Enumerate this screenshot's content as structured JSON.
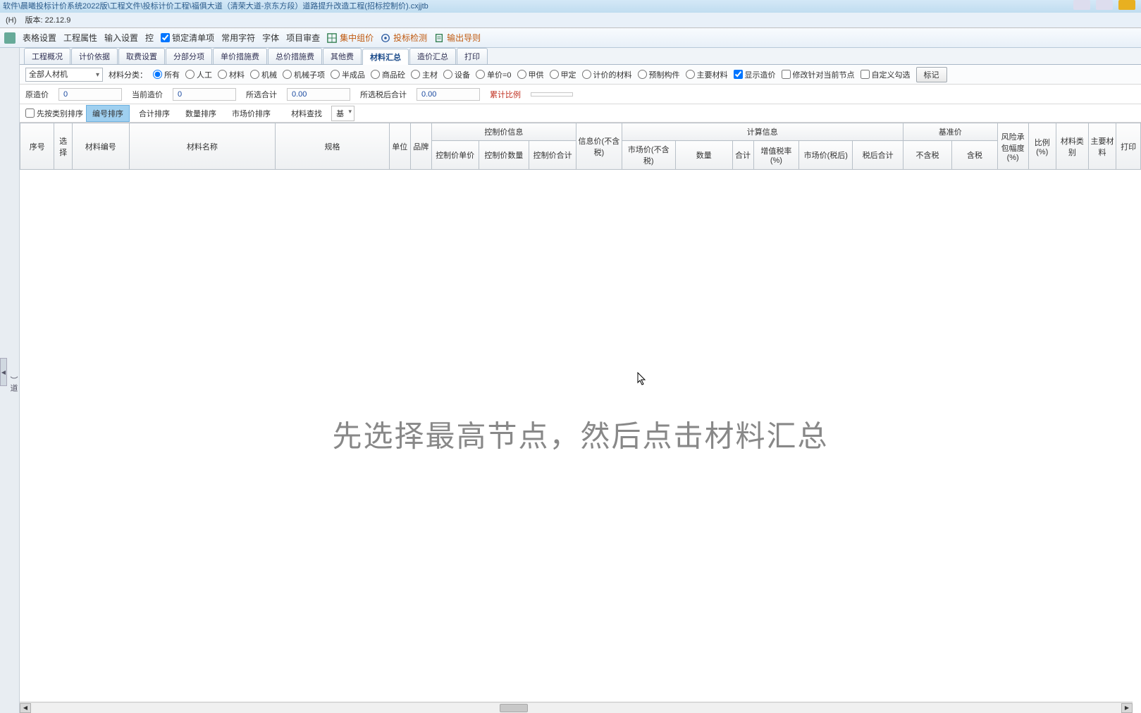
{
  "title_bar": "软件\\晨曦投标计价系统2022版\\工程文件\\投标计价工程\\福俱大道（清荣大道-京东方段）道路提升改造工程(招标控制价).cxjjtb",
  "menu_row": {
    "left": "(H)",
    "version_label": "版本:",
    "version": "22.12.9"
  },
  "toolbar": {
    "items": [
      "表格设置",
      "工程属性",
      "输入设置",
      "控"
    ],
    "lock_chk": "锁定清单项",
    "items2": [
      "常用字符",
      "字体",
      "项目审查"
    ],
    "special": [
      {
        "icon": "grid-icon",
        "label": "集中组价",
        "color": "#c05a10"
      },
      {
        "icon": "target-icon",
        "label": "投标检测",
        "color": "#c05a10"
      },
      {
        "icon": "export-icon",
        "label": "输出导则",
        "color": "#c05a10"
      }
    ]
  },
  "left_strip": "）道",
  "tabs": [
    "工程概况",
    "计价依据",
    "取费设置",
    "分部分项",
    "单价措施费",
    "总价措施费",
    "其他费",
    "材料汇总",
    "造价汇总",
    "打印"
  ],
  "tabs_active_index": 7,
  "filter": {
    "combo": "全部人材机",
    "label": "材料分类：",
    "radios": [
      "所有",
      "人工",
      "材料",
      "机械",
      "机械子项",
      "半成品",
      "商品砼",
      "主材",
      "设备",
      "单价=0",
      "甲供",
      "甲定",
      "计价的材料",
      "预制构件",
      "主要材料"
    ],
    "radio_selected": 0,
    "chks": [
      {
        "label": "显示造价",
        "checked": true
      },
      {
        "label": "修改针对当前节点",
        "checked": false
      },
      {
        "label": "自定义勾选",
        "checked": false
      }
    ],
    "mark_btn": "标记"
  },
  "price_row": {
    "orig_label": "原造价",
    "orig_val": "0",
    "cur_label": "当前造价",
    "cur_val": "0",
    "sel_label": "所选合计",
    "sel_val": "0.00",
    "tax_label": "所选税后合计",
    "tax_val": "0.00",
    "ratio_label": "累计比例",
    "ratio_val": ""
  },
  "sort_row": {
    "first_chk": "先按类别排序",
    "btns": [
      "编号排序",
      "合计排序",
      "数量排序",
      "市场价排序"
    ],
    "selected": 0,
    "search": "材料查找",
    "base": "基"
  },
  "grid_headers": {
    "col_seq": "序号",
    "col_sel": "选择",
    "col_code": "材料编号",
    "col_name": "材料名称",
    "col_spec": "规格",
    "col_unit": "单位",
    "col_brand": "品牌",
    "grp_ctrl": "控制价信息",
    "col_ctrl_price": "控制价单价",
    "col_ctrl_qty": "控制价数量",
    "col_ctrl_total": "控制价合计",
    "col_info_price": "信息价(不含税)",
    "grp_calc": "计算信息",
    "col_market_notax": "市场价(不含税)",
    "col_qty": "数量",
    "col_sum": "合计",
    "col_vat": "增值税率(%)",
    "col_market_aftertax": "市场价(税后)",
    "col_aftertax_total": "税后合计",
    "grp_base": "基准价",
    "col_notax": "不含税",
    "col_tax": "含税",
    "col_risk": "风险承包幅度(%)",
    "col_ratio": "比例(%)",
    "col_cat": "材料类别",
    "col_main": "主要材料",
    "col_print": "打印"
  },
  "watermark": "先选择最高节点，然后点击材料汇总"
}
